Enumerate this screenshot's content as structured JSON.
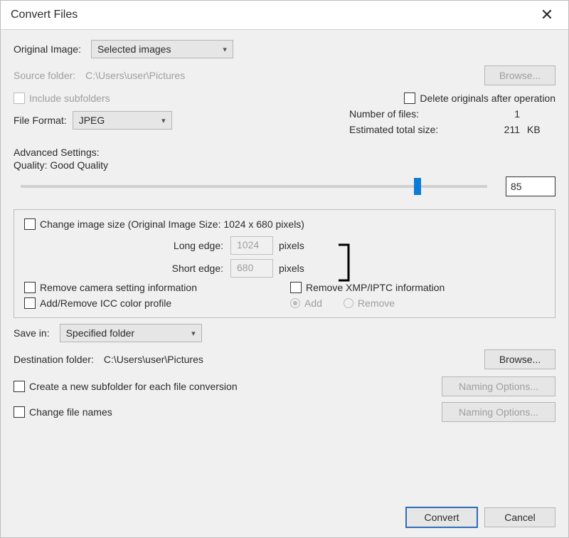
{
  "title": "Convert Files",
  "original_image_label": "Original Image:",
  "original_image_value": "Selected images",
  "source_folder_label": "Source folder:",
  "source_folder_path": "C:\\Users\\user\\Pictures",
  "browse_label": "Browse...",
  "include_subfolders": "Include subfolders",
  "delete_originals": "Delete originals after operation",
  "file_format_label": "File Format:",
  "file_format_value": "JPEG",
  "num_files_label": "Number of files:",
  "num_files_value": "1",
  "est_size_label": "Estimated total size:",
  "est_size_value": "211",
  "est_size_unit": "KB",
  "advanced_label": "Advanced Settings:",
  "quality_label": "Quality: Good Quality",
  "quality_value": "85",
  "change_size_label": "Change image size (Original Image Size: 1024 x 680 pixels)",
  "long_edge_label": "Long edge:",
  "long_edge_value": "1024",
  "short_edge_label": "Short edge:",
  "short_edge_value": "680",
  "pixels": "pixels",
  "remove_camera": "Remove camera setting information",
  "remove_xmp": "Remove XMP/IPTC information",
  "icc_profile": "Add/Remove ICC color profile",
  "icc_add": "Add",
  "icc_remove": "Remove",
  "save_in_label": "Save in:",
  "save_in_value": "Specified folder",
  "dest_folder_label": "Destination folder:",
  "dest_folder_path": "C:\\Users\\user\\Pictures",
  "create_subfolder": "Create a new subfolder for each file conversion",
  "naming_options": "Naming Options...",
  "change_file_names": "Change file names",
  "convert": "Convert",
  "cancel": "Cancel"
}
